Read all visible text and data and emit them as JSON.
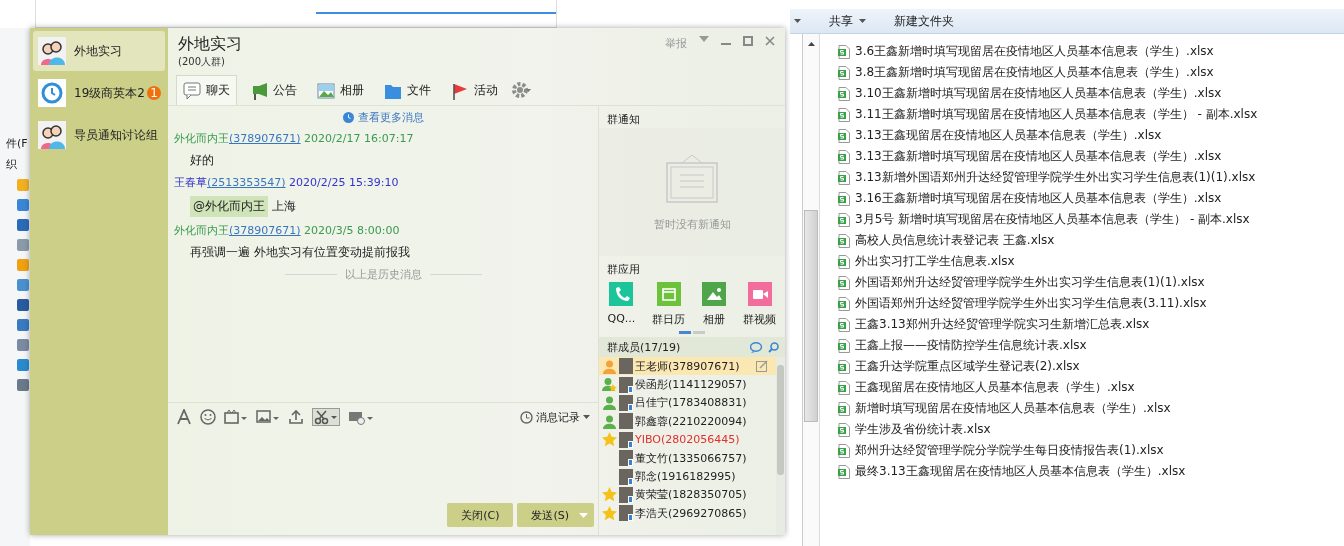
{
  "background_window": {
    "menu_fragment": "件(F",
    "toolbar_fragment": "织"
  },
  "qq_window": {
    "sidebar": {
      "items": [
        {
          "name": "外地实习",
          "kind": "group",
          "selected": true
        },
        {
          "name": "19级商英本2",
          "kind": "clock",
          "badge": "1",
          "selected": false
        },
        {
          "name": "导员通知讨论组",
          "kind": "group",
          "selected": false
        }
      ]
    },
    "header": {
      "title": "外地实习",
      "subtitle": "(200人群)",
      "report": "举报"
    },
    "tabs": [
      {
        "label": "聊天",
        "kind": "chat",
        "selected": true
      },
      {
        "label": "公告",
        "kind": "notice",
        "selected": false
      },
      {
        "label": "相册",
        "kind": "album",
        "selected": false
      },
      {
        "label": "文件",
        "kind": "file",
        "selected": false
      },
      {
        "label": "活动",
        "kind": "event",
        "selected": false
      }
    ],
    "chat": {
      "more_link": "查看更多消息",
      "messages": [
        {
          "sender": "外化而内王",
          "qq": "(378907671)",
          "time": "2020/2/17 16:07:17",
          "color": "#3a9a4f",
          "text": "好的"
        },
        {
          "sender": "王春草",
          "qq": "(2513353547)",
          "time": "2020/2/25 15:39:10",
          "color": "#3434c8",
          "mention": "@外化而内王",
          "text": "上海"
        },
        {
          "sender": "外化而内王",
          "qq": "(378907671)",
          "time": "2020/3/5 8:00:00",
          "color": "#3a9a4f",
          "text": "再强调一遍  外地实习有位置变动提前报我"
        }
      ],
      "history_divider": "以上是历史消息"
    },
    "input_toolbar": {
      "history": "消息记录"
    },
    "buttons": {
      "close": "关闭(C)",
      "send": "发送(S)"
    },
    "notice": {
      "title": "群通知",
      "empty": "暂时没有新通知"
    },
    "apps": {
      "title": "群应用",
      "items": [
        {
          "label": "QQ...",
          "kind": "phone",
          "color": "#1cc49a"
        },
        {
          "label": "群日历",
          "kind": "calendar",
          "color": "#6cc23a"
        },
        {
          "label": "相册",
          "kind": "photo",
          "color": "#4ea54a"
        },
        {
          "label": "群视频",
          "kind": "video",
          "color": "#f36d9c"
        }
      ]
    },
    "members": {
      "title": "群成员(17/19)",
      "items": [
        {
          "label": "王老师(378907671)",
          "kind": "owner",
          "mobile": false,
          "color": "#222222",
          "selected": true
        },
        {
          "label": "侯函彤(1141129057)",
          "kind": "admin_star",
          "mobile": true,
          "color": "#222222",
          "selected": false
        },
        {
          "label": "吕佳宁(1783408831)",
          "kind": "admin",
          "mobile": true,
          "color": "#222222",
          "selected": false
        },
        {
          "label": "郭鑫蓉(2210220094)",
          "kind": "admin",
          "mobile": false,
          "color": "#222222",
          "selected": false
        },
        {
          "label": "YIBO(2802056445)",
          "kind": "star",
          "mobile": true,
          "color": "#e0302c",
          "selected": false
        },
        {
          "label": "董文竹(1335066757)",
          "kind": "none",
          "mobile": true,
          "color": "#222222",
          "selected": false
        },
        {
          "label": "郭念(1916182995)",
          "kind": "none",
          "mobile": true,
          "color": "#222222",
          "selected": false
        },
        {
          "label": "黄荣莹(1828350705)",
          "kind": "star",
          "mobile": true,
          "color": "#222222",
          "selected": false
        },
        {
          "label": "李浩天(2969270865)",
          "kind": "star",
          "mobile": true,
          "color": "#222222",
          "selected": false
        }
      ]
    }
  },
  "explorer": {
    "toolbar": [
      {
        "label": "共享",
        "dropdown": true
      },
      {
        "label": "新建文件夹",
        "dropdown": false
      }
    ],
    "files": [
      "3.6王鑫新增时填写现留居在疫情地区人员基本信息表（学生）.xlsx",
      "3.8王鑫新增时填写现留居在疫情地区人员基本信息表（学生）.xlsx",
      "3.10王鑫新增时填写现留居在疫情地区人员基本信息表（学生）.xlsx",
      "3.11王鑫新增时填写现留居在疫情地区人员基本信息表（学生） - 副本.xlsx",
      "3.13王鑫现留居在疫情地区人员基本信息表（学生）.xlsx",
      "3.13王鑫新增时填写现留居在疫情地区人员基本信息表（学生）.xlsx",
      "3.13新增外国语郑州升达经贸管理学院学生外出实习学生信息表(1)(1).xlsx",
      "3.16王鑫新增时填写现留居在疫情地区人员基本信息表（学生）.xlsx",
      "3月5号 新增时填写现留居在疫情地区人员基本信息表（学生） - 副本.xlsx",
      "高校人员信息统计表登记表 王鑫.xlsx",
      "外出实习打工学生信息表.xlsx",
      "外国语郑州升达经贸管理学院学生外出实习学生信息表(1)(1).xlsx",
      "外国语郑州升达经贸管理学院学生外出实习学生信息表(3.11).xlsx",
      "王鑫3.13郑州升达经贸管理学院实习生新增汇总表.xlsx",
      "王鑫上报——疫情防控学生信息统计表.xlsx",
      "王鑫升达学院重点区域学生登记表(2).xlsx",
      "王鑫现留居在疫情地区人员基本信息表（学生）.xlsx",
      "新增时填写现留居在疫情地区人员基本信息表（学生）.xlsx",
      "学生涉及省份统计表.xlsx",
      "郑州升达经贸管理学院分学院学生每日疫情报告表(1).xlsx",
      "最终3.13王鑫现留居在疫情地区人员基本信息表（学生）.xlsx"
    ]
  }
}
